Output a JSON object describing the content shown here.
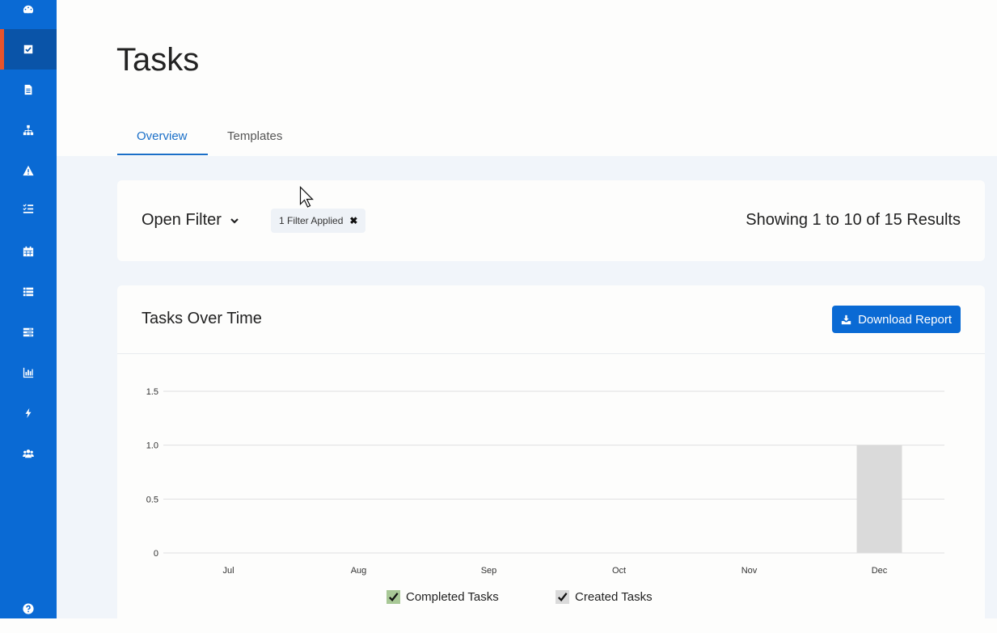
{
  "sidebar": {
    "items": [
      {
        "icon": "dashboard-icon"
      },
      {
        "icon": "check-square-icon",
        "active": true
      },
      {
        "icon": "document-icon"
      },
      {
        "icon": "org-chart-icon"
      },
      {
        "icon": "warning-icon"
      },
      {
        "icon": "checklist-icon"
      },
      {
        "icon": "calendar-icon"
      },
      {
        "icon": "list-icon"
      },
      {
        "icon": "server-icon"
      },
      {
        "icon": "bar-chart-icon"
      },
      {
        "icon": "lightning-icon"
      },
      {
        "icon": "users-icon"
      }
    ],
    "help_icon": "help-icon"
  },
  "page": {
    "title": "Tasks",
    "tabs": [
      {
        "label": "Overview",
        "active": true
      },
      {
        "label": "Templates",
        "active": false
      }
    ]
  },
  "filter": {
    "open_label": "Open Filter",
    "chip_label": "1 Filter Applied",
    "results_text": "Showing 1 to 10 of 15 Results"
  },
  "chart_card": {
    "title": "Tasks Over Time",
    "download_label": "Download Report"
  },
  "colors": {
    "accent": "#0a6ad4",
    "active_marker": "#e8542b",
    "completed_series": "#a8c896",
    "created_series": "#dadada"
  },
  "chart_data": {
    "type": "bar",
    "categories": [
      "Jul",
      "Aug",
      "Sep",
      "Oct",
      "Nov",
      "Dec"
    ],
    "series": [
      {
        "name": "Completed Tasks",
        "values": [
          0,
          0,
          0,
          0,
          0,
          0
        ],
        "color": "#a8c896"
      },
      {
        "name": "Created Tasks",
        "values": [
          0,
          0,
          0,
          0,
          0,
          1
        ],
        "color": "#dadada"
      }
    ],
    "yticks": [
      "0",
      "0.5",
      "1.0",
      "1.5"
    ],
    "ylim": [
      0,
      1.5
    ],
    "grid": true,
    "legend_position": "bottom"
  }
}
